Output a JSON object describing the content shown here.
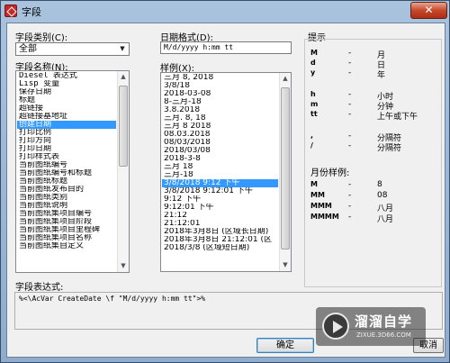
{
  "window": {
    "title": "字段",
    "close_glyph": "✕"
  },
  "field_category": {
    "label": "字段类别(C):",
    "value": "全部"
  },
  "field_names": {
    "label": "字段名称(N):",
    "items": [
      "Diesel 表达式",
      "Lisp 变量",
      "保存日期",
      "标题",
      "超链接",
      "超链接基地址",
      "创建日期",
      "打印比例",
      "打印方向",
      "打印日期",
      "打印样式表",
      "当前图纸编号",
      "当前图纸编号和标题",
      "当前图纸标题",
      "当前图纸发布目的",
      "当前图纸类别",
      "当前图纸说明",
      "当前图纸集项目编号",
      "当前图纸集项目阶段",
      "当前图纸集项目里程碑",
      "当前图纸集项目名称",
      "当前图纸集自定义"
    ],
    "selected": "创建日期"
  },
  "date_format": {
    "label": "日期格式(D):",
    "value": "M/d/yyyy h:mm tt"
  },
  "examples": {
    "label": "样例(X):",
    "items": [
      "三月 8, 2018",
      "3/8/18",
      "2018-03-08",
      "8-三月-18",
      "3.8.2018",
      "三月. 8, 18",
      "三月 8 2018",
      "08.03.2018",
      "08/03/2018",
      "2018/03/08",
      "2018-3-8",
      "三月 18",
      "三月-18",
      "3/8/2018 9:12 下午",
      "3/8/2018 9:12:01 下午",
      "9:12 下午",
      "9:12:01 下午",
      "21:12",
      "21:12:01",
      "2018年3月8日 (区域长日期)",
      "2018年3月8日 21:12:01 (区",
      "2018/3/8 (区域短日期)"
    ],
    "selected": "3/8/2018 9:12 下午"
  },
  "hints": {
    "label": "提示",
    "rows": [
      {
        "k": "M",
        "d": "-",
        "v": "月"
      },
      {
        "k": "d",
        "d": "-",
        "v": "日"
      },
      {
        "k": "y",
        "d": "-",
        "v": "年"
      },
      {
        "k": "h",
        "d": "-",
        "v": "小时"
      },
      {
        "k": "m",
        "d": "-",
        "v": "分钟"
      },
      {
        "k": "tt",
        "d": "-",
        "v": "上午或下午"
      },
      {
        "k": ",",
        "d": "-",
        "v": "分隔符"
      },
      {
        "k": "/",
        "d": "-",
        "v": "分隔符"
      }
    ],
    "month_label": "月份样例:",
    "month_rows": [
      {
        "k": "M",
        "d": "-",
        "v": "8"
      },
      {
        "k": "MM",
        "d": "-",
        "v": "08"
      },
      {
        "k": "MMM",
        "d": "-",
        "v": "八月"
      },
      {
        "k": "MMMM",
        "d": "-",
        "v": "八月"
      }
    ]
  },
  "expression": {
    "label": "字段表达式:",
    "value": "%<\\AcVar CreateDate \\f \"M/d/yyyy h:mm tt\">%"
  },
  "buttons": {
    "ok": "确定",
    "cancel": "取消"
  },
  "watermark": {
    "brand": "溜溜自学",
    "url": "ZIXUE.3D66.COM"
  }
}
